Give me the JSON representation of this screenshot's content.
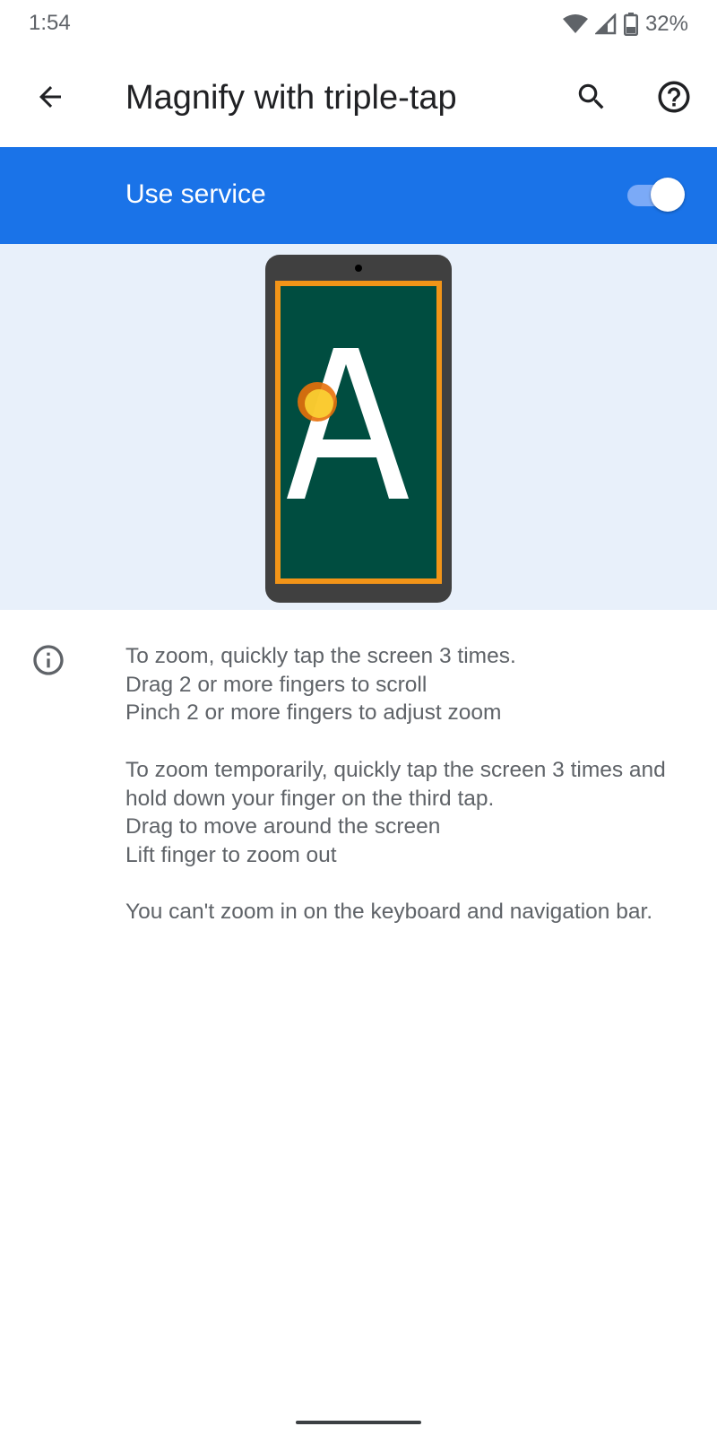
{
  "status_bar": {
    "time": "1:54",
    "battery": "32%"
  },
  "app_bar": {
    "title": "Magnify with triple-tap",
    "icons": [
      "back-arrow-icon",
      "search-icon",
      "help-icon"
    ]
  },
  "service": {
    "label": "Use service",
    "enabled": true,
    "accent_color": "#1a73e8"
  },
  "illustration": {
    "letter": "A",
    "screen_color": "#004d40",
    "border_color": "#f29418"
  },
  "info": {
    "icon": "info-icon",
    "paragraphs": [
      [
        "To zoom, quickly tap the screen 3 times.",
        "Drag 2 or more fingers to scroll",
        "Pinch 2 or more fingers to adjust zoom"
      ],
      [
        "To zoom temporarily, quickly tap the screen 3 times and hold down your finger on the third tap.",
        "Drag to move around the screen",
        "Lift finger to zoom out"
      ],
      [
        "You can't zoom in on the keyboard and navigation bar."
      ]
    ]
  }
}
